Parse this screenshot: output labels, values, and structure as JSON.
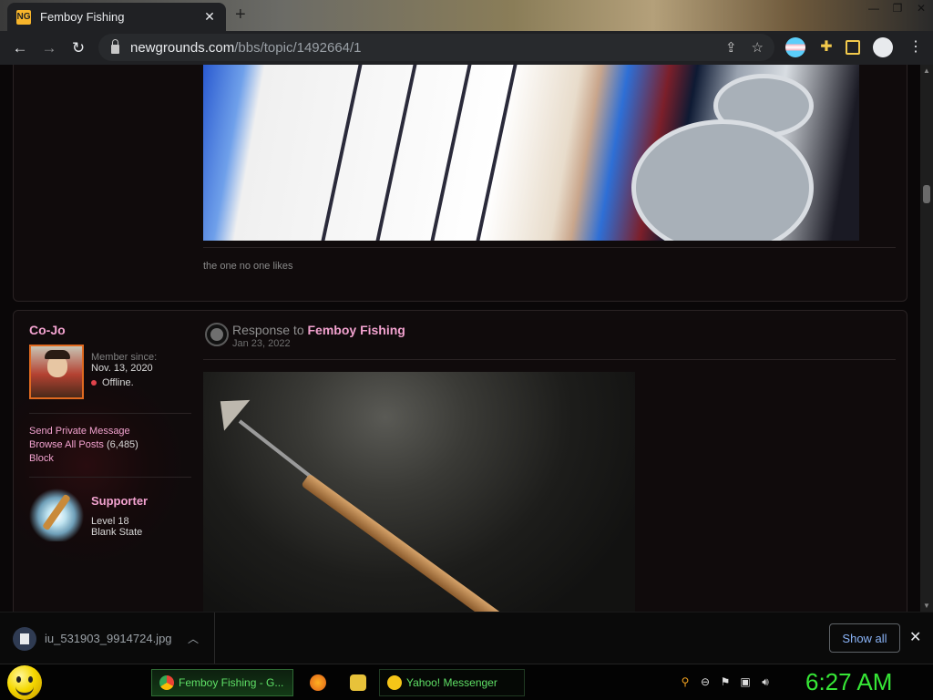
{
  "browser": {
    "tab_title": "Femboy Fishing",
    "tab_favicon": "NG",
    "url_domain": "newgrounds.com",
    "url_path": "/bbs/topic/1492664/1"
  },
  "post_prev": {
    "caption": "the one no one likes"
  },
  "post": {
    "username": "Co-Jo",
    "member_since_label": "Member since:",
    "member_since_date": "Nov. 13, 2020",
    "status": "Offline.",
    "links": {
      "send_pm": "Send Private Message",
      "browse_posts": "Browse All Posts",
      "browse_count": "(6,485)",
      "block": "Block"
    },
    "rank": "Supporter",
    "level": "Level 18",
    "level_title": "Blank State",
    "response_prefix": "Response to",
    "topic": "Femboy Fishing",
    "date": "Jan 23, 2022"
  },
  "download": {
    "filename": "iu_531903_9914724.jpg",
    "show_all": "Show all"
  },
  "taskbar": {
    "chrome_task": "Femboy Fishing - G...",
    "ym_task": "Yahoo! Messenger",
    "clock": "6:27 AM"
  },
  "colors": {
    "accent_pink": "#f2a2cf",
    "offline_red": "#e0434b",
    "clock_green": "#36e636",
    "link_blue": "#8ab4f8"
  }
}
